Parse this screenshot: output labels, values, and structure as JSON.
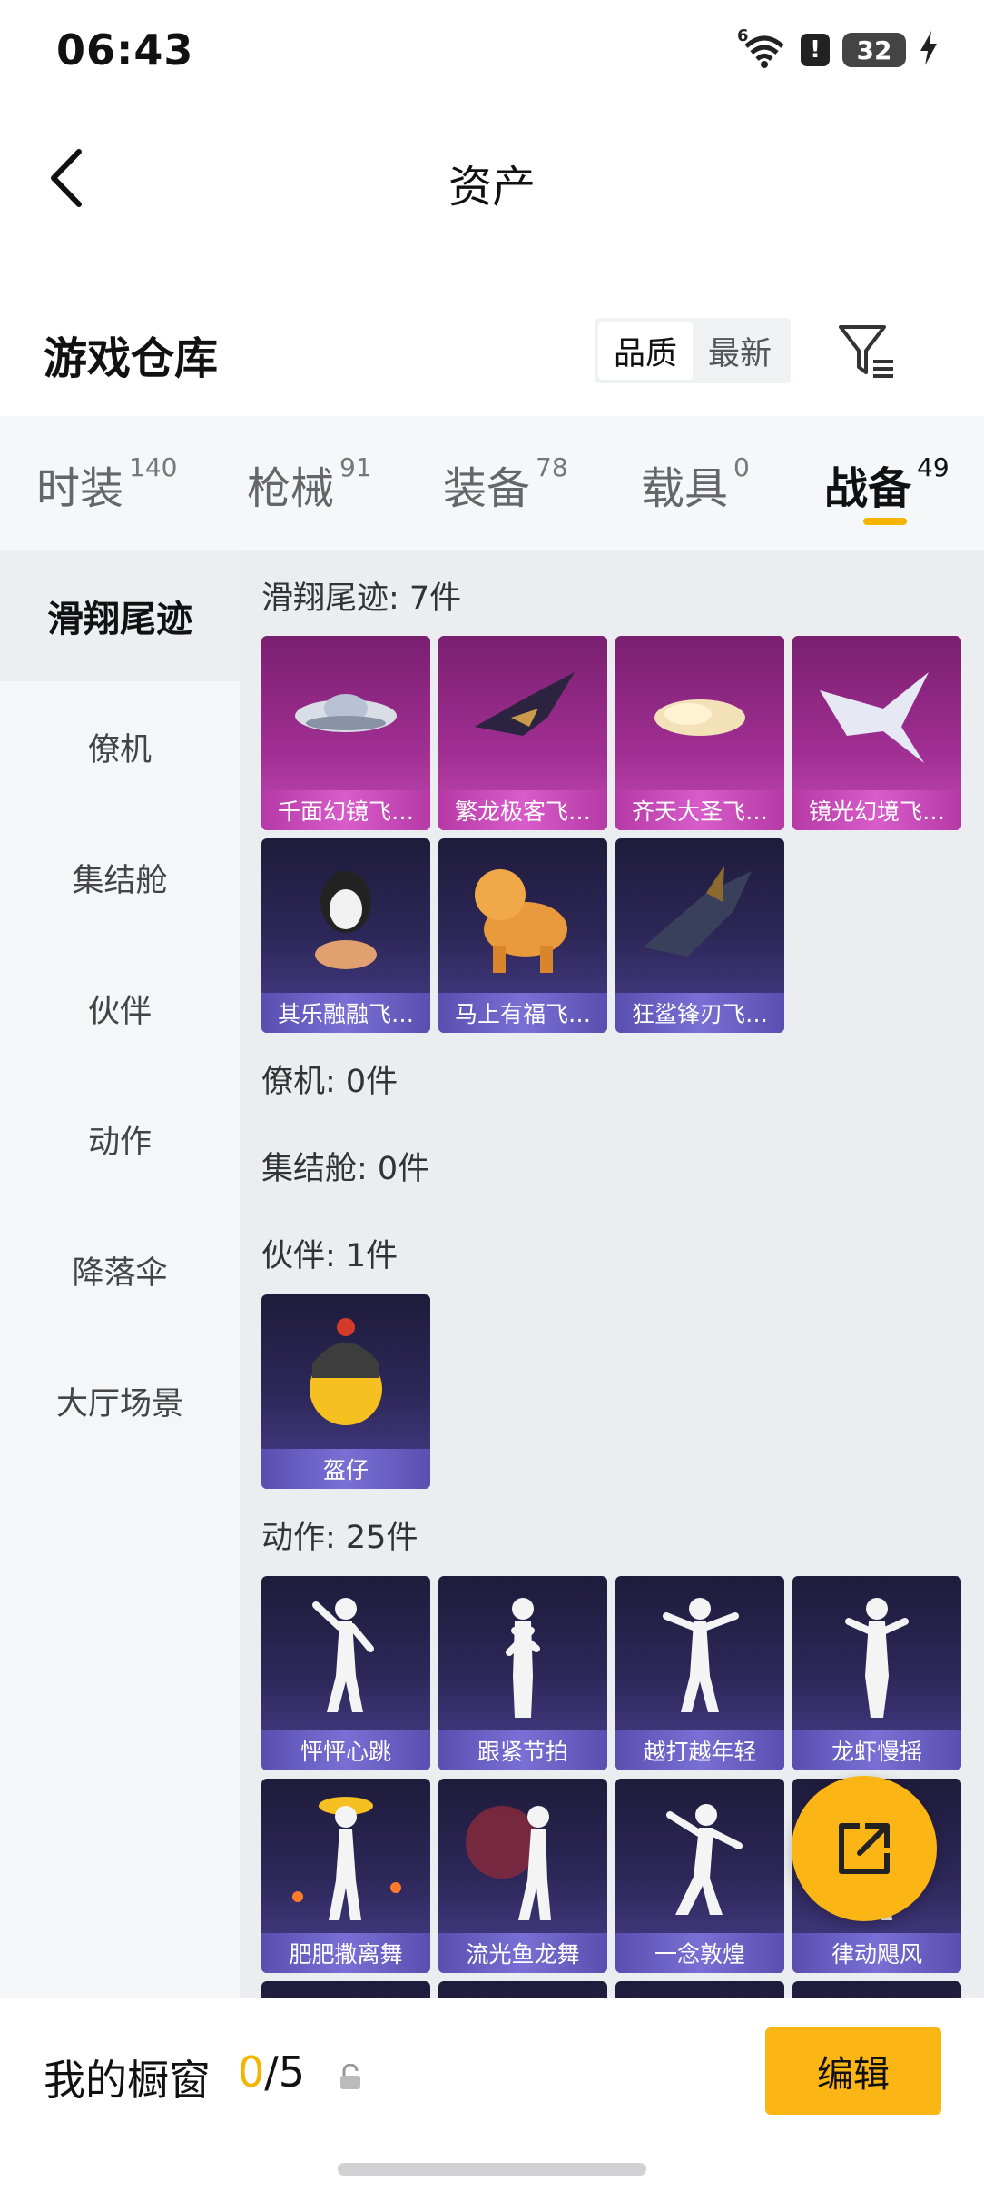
{
  "status_bar": {
    "time": "06:43",
    "battery": "32",
    "network": "6"
  },
  "header": {
    "title": "资产"
  },
  "warehouse": {
    "title": "游戏仓库",
    "sort_options": [
      "品质",
      "最新"
    ]
  },
  "tabs": [
    {
      "label": "时装",
      "count": "140"
    },
    {
      "label": "枪械",
      "count": "91"
    },
    {
      "label": "装备",
      "count": "78"
    },
    {
      "label": "载具",
      "count": "0"
    },
    {
      "label": "战备",
      "count": "49"
    }
  ],
  "sidebar": {
    "items": [
      {
        "label": "滑翔尾迹"
      },
      {
        "label": "僚机"
      },
      {
        "label": "集结舱"
      },
      {
        "label": "伙伴"
      },
      {
        "label": "动作"
      },
      {
        "label": "降落伞"
      },
      {
        "label": "大厅场景"
      }
    ]
  },
  "sections": {
    "glide": {
      "title": "滑翔尾迹: 7件",
      "items": [
        "千面幻镜飞…",
        "繁龙极客飞…",
        "齐天大圣飞…",
        "镜光幻境飞…",
        "其乐融融飞…",
        "马上有福飞…",
        "狂鲨锋刃飞…"
      ]
    },
    "wingman": {
      "title": "僚机: 0件"
    },
    "pod": {
      "title": "集结舱: 0件"
    },
    "partner": {
      "title": "伙伴: 1件",
      "items": [
        "盔仔"
      ]
    },
    "emote": {
      "title": "动作: 25件",
      "items": [
        "怦怦心跳",
        "跟紧节拍",
        "越打越年轻",
        "龙虾慢摇",
        "肥肥撒离舞",
        "流光鱼龙舞",
        "一念敦煌",
        "律动飓风"
      ]
    }
  },
  "bottom_bar": {
    "label": "我的橱窗",
    "current": "0",
    "total": "/5",
    "edit_label": "编辑"
  },
  "colors": {
    "accent": "#fbb514",
    "rarity_legendary": "#a12f93",
    "rarity_epic": "#4a3f8e"
  }
}
